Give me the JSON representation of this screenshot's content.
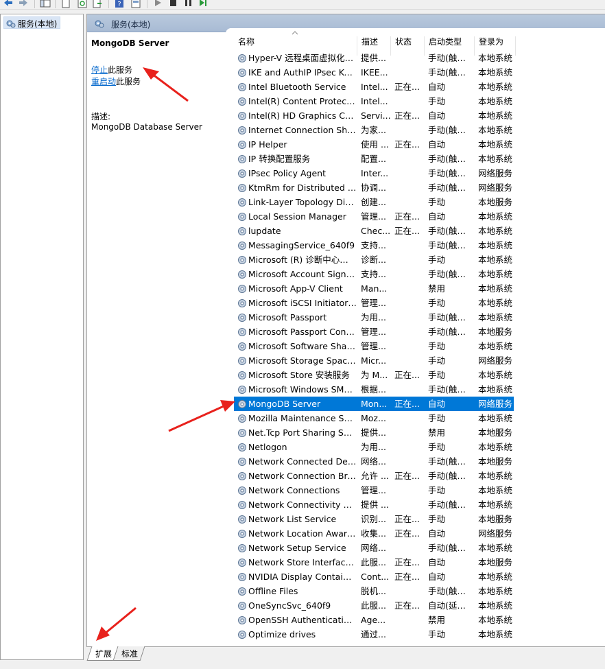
{
  "tree": {
    "root_label": "服务(本地)"
  },
  "header": {
    "title": "服务(本地)"
  },
  "detail": {
    "service_name": "MongoDB Server",
    "stop_link": "停止",
    "stop_suffix": "此服务",
    "restart_link": "重启动",
    "restart_suffix": "此服务",
    "desc_label": "描述:",
    "desc_text": "MongoDB Database Server"
  },
  "columns": {
    "name": "名称",
    "desc": "描述",
    "state": "状态",
    "start": "启动类型",
    "logon": "登录为"
  },
  "rows": [
    [
      "Hyper-V 远程桌面虚拟化服务",
      "提供...",
      "",
      "手动(触发...",
      "本地系统"
    ],
    [
      "IKE and AuthIP IPsec Keying Modules",
      "IKEE...",
      "",
      "手动(触发...",
      "本地系统"
    ],
    [
      "Intel Bluetooth Service",
      "Intel...",
      "正在...",
      "自动",
      "本地系统"
    ],
    [
      "Intel(R) Content Protection HECI Service",
      "Intel...",
      "",
      "手动",
      "本地系统"
    ],
    [
      "Intel(R) HD Graphics Control Panel Service",
      "Servi...",
      "正在...",
      "自动",
      "本地系统"
    ],
    [
      "Internet Connection Sharing (ICS)",
      "为家...",
      "",
      "手动(触发...",
      "本地系统"
    ],
    [
      "IP Helper",
      "使用 ...",
      "正在...",
      "自动",
      "本地系统"
    ],
    [
      "IP 转换配置服务",
      "配置...",
      "",
      "手动(触发...",
      "本地系统"
    ],
    [
      "IPsec Policy Agent",
      "Inter...",
      "",
      "手动(触发...",
      "网络服务"
    ],
    [
      "KtmRm for Distributed Transaction Coordinator",
      "协调...",
      "",
      "手动(触发...",
      "网络服务"
    ],
    [
      "Link-Layer Topology Discovery Mapper",
      "创建...",
      "",
      "手动",
      "本地服务"
    ],
    [
      "Local Session Manager",
      "管理...",
      "正在...",
      "自动",
      "本地系统"
    ],
    [
      "lupdate",
      "Chec...",
      "正在...",
      "手动(触发...",
      "本地系统"
    ],
    [
      "MessagingService_640f9",
      "支持...",
      "",
      "手动(触发...",
      "本地系统"
    ],
    [
      "Microsoft (R) 诊断中心标准收集器服务",
      "诊断...",
      "",
      "手动",
      "本地系统"
    ],
    [
      "Microsoft Account Sign-in Assistant",
      "支持...",
      "",
      "手动(触发...",
      "本地系统"
    ],
    [
      "Microsoft App-V Client",
      "Man...",
      "",
      "禁用",
      "本地系统"
    ],
    [
      "Microsoft iSCSI Initiator Service",
      "管理...",
      "",
      "手动",
      "本地系统"
    ],
    [
      "Microsoft Passport",
      "为用...",
      "",
      "手动(触发...",
      "本地系统"
    ],
    [
      "Microsoft Passport Container",
      "管理...",
      "",
      "手动(触发...",
      "本地服务"
    ],
    [
      "Microsoft Software Shadow Copy Provider",
      "管理...",
      "",
      "手动",
      "本地系统"
    ],
    [
      "Microsoft Storage Spaces SMP",
      "Micr...",
      "",
      "手动",
      "网络服务"
    ],
    [
      "Microsoft Store 安装服务",
      "为 M...",
      "正在...",
      "手动",
      "本地系统"
    ],
    [
      "Microsoft Windows SMS 路由器服务。",
      "根据...",
      "",
      "手动(触发...",
      "本地系统"
    ],
    [
      "MongoDB Server",
      "Mon...",
      "正在...",
      "自动",
      "网络服务"
    ],
    [
      "Mozilla Maintenance Service",
      "Moz...",
      "",
      "手动",
      "本地系统"
    ],
    [
      "Net.Tcp Port Sharing Service",
      "提供...",
      "",
      "禁用",
      "本地服务"
    ],
    [
      "Netlogon",
      "为用...",
      "",
      "手动",
      "本地系统"
    ],
    [
      "Network Connected Devices Auto-Setup",
      "网络...",
      "",
      "手动(触发...",
      "本地服务"
    ],
    [
      "Network Connection Broker",
      "允许 ...",
      "正在...",
      "手动(触发...",
      "本地系统"
    ],
    [
      "Network Connections",
      "管理...",
      "",
      "手动",
      "本地系统"
    ],
    [
      "Network Connectivity Assistant",
      "提供 ...",
      "",
      "手动(触发...",
      "本地系统"
    ],
    [
      "Network List Service",
      "识别...",
      "正在...",
      "手动",
      "本地服务"
    ],
    [
      "Network Location Awareness",
      "收集...",
      "正在...",
      "自动",
      "网络服务"
    ],
    [
      "Network Setup Service",
      "网络...",
      "",
      "手动(触发...",
      "本地系统"
    ],
    [
      "Network Store Interface Service",
      "此服...",
      "正在...",
      "自动",
      "本地服务"
    ],
    [
      "NVIDIA Display Container LS",
      "Cont...",
      "正在...",
      "自动",
      "本地系统"
    ],
    [
      "Offline Files",
      "脱机...",
      "",
      "手动(触发...",
      "本地系统"
    ],
    [
      "OneSyncSvc_640f9",
      "此服...",
      "正在...",
      "自动(延迟...",
      "本地系统"
    ],
    [
      "OpenSSH Authentication Agent",
      "Age...",
      "",
      "禁用",
      "本地系统"
    ],
    [
      "Optimize drives",
      "通过...",
      "",
      "手动",
      "本地系统"
    ]
  ],
  "selected_row": 24,
  "tabs": {
    "extended": "扩展",
    "standard": "标准"
  },
  "colors": {
    "selection": "#0078d7",
    "link": "#0066cc",
    "annotation_arrow": "#e8211c"
  }
}
